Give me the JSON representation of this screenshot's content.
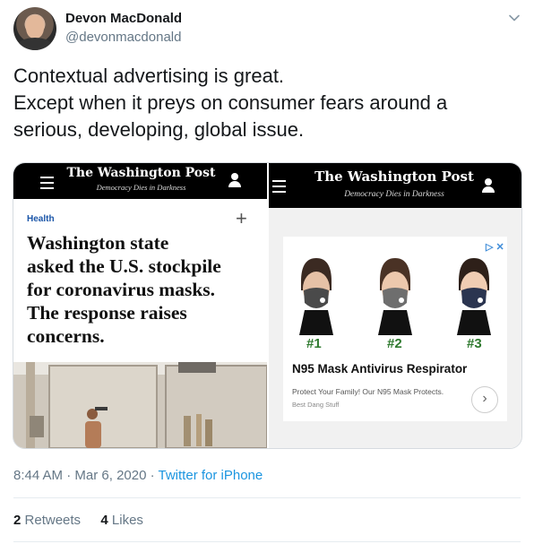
{
  "author": {
    "display_name": "Devon MacDonald",
    "handle": "@devonmacdonald"
  },
  "tweet": {
    "lines": [
      "Contextual advertising is great.",
      "Except when it preys on consumer fears around a",
      "serious, developing, global issue."
    ]
  },
  "media_left": {
    "masthead": "The Washington Post",
    "tagline": "Democracy Dies in Darkness",
    "section": "Health",
    "headline_lines": [
      "Washington state",
      "asked the U.S. stockpile",
      "for coronavirus masks.",
      "The response raises",
      "concerns."
    ]
  },
  "media_right": {
    "masthead": "The Washington Post",
    "tagline": "Democracy Dies in Darkness",
    "ad": {
      "labels": [
        "#1",
        "#2",
        "#3"
      ],
      "mask_colors": [
        "#4a4a4a",
        "#6e6e6e",
        "#2b3550"
      ],
      "title": "N95 Mask Antivirus Respirator",
      "description": "Protect Your Family! Our N95 Mask Protects.",
      "brand": "Best Dang Stuff"
    }
  },
  "footer": {
    "time": "8:44 AM",
    "date": "Mar 6, 2020",
    "source": "Twitter for iPhone",
    "retweets_count": "2",
    "retweets_label": "Retweets",
    "likes_count": "4",
    "likes_label": "Likes"
  },
  "icons": {
    "chevron": "chevron-down-icon",
    "menu": "hamburger-menu-icon",
    "user": "user-icon",
    "plus": "plus-icon",
    "ad_choices": "ad-choices-icon",
    "close": "close-icon",
    "next": "chevron-right-icon"
  },
  "colors": {
    "link": "#1b95e0",
    "muted": "#657786",
    "wp_section": "#1a55a8",
    "mask_number": "#2f7a2f"
  }
}
